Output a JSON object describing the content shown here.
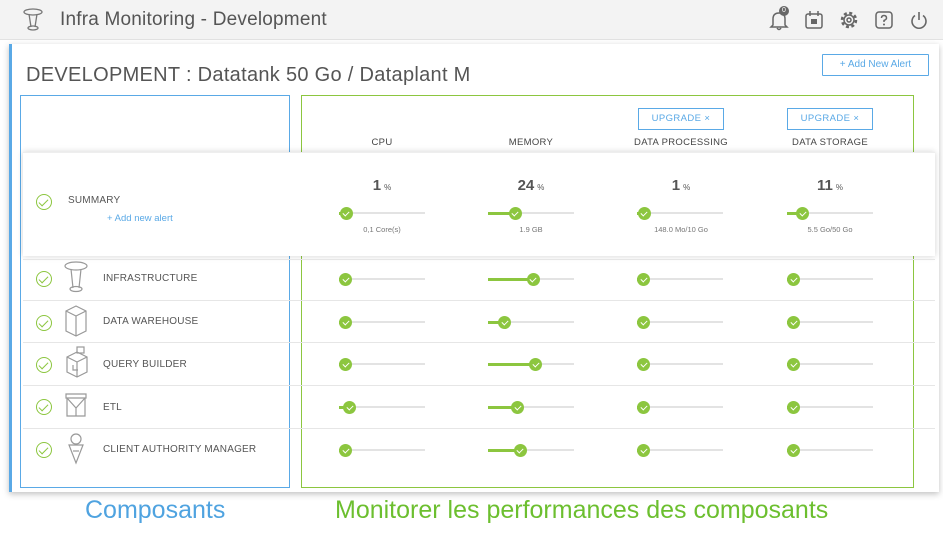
{
  "app": {
    "title": "Infra Monitoring - Development",
    "logo_icon": "infra-logo-icon",
    "notifications_count": "0",
    "header_icons": [
      "bell-icon",
      "calendar-icon",
      "gear-icon",
      "help-icon",
      "power-icon"
    ]
  },
  "page": {
    "title": "DEVELOPMENT : Datatank 50 Go / Dataplant M",
    "add_alert_label": "+ Add New Alert"
  },
  "columns": [
    {
      "key": "cpu",
      "label": "CPU",
      "upgrade": ""
    },
    {
      "key": "memory",
      "label": "MEMORY",
      "upgrade": ""
    },
    {
      "key": "processing",
      "label": "DATA PROCESSING",
      "upgrade": "UPGRADE ×"
    },
    {
      "key": "storage",
      "label": "DATA STORAGE",
      "upgrade": "UPGRADE ×"
    }
  ],
  "summary": {
    "label": "SUMMARY",
    "add_alert": "+ Add new alert",
    "cells": [
      {
        "value": "1",
        "unit": "%",
        "detail": "0,1 Core(s)",
        "level": 0.01
      },
      {
        "value": "24",
        "unit": "%",
        "detail": "1.9 GB",
        "level": 0.24
      },
      {
        "value": "1",
        "unit": "%",
        "detail": "148.0 Mo/10 Go",
        "level": 0.01
      },
      {
        "value": "11",
        "unit": "%",
        "detail": "5.5 Go/50 Go",
        "level": 0.11
      }
    ]
  },
  "components": [
    {
      "label": "INFRASTRUCTURE",
      "icon": "infrastructure-icon",
      "levels": [
        0.0,
        0.45,
        0.0,
        0.0
      ]
    },
    {
      "label": "DATA WAREHOUSE",
      "icon": "data-warehouse-icon",
      "levels": [
        0.0,
        0.12,
        0.0,
        0.0
      ]
    },
    {
      "label": "QUERY BUILDER",
      "icon": "query-builder-icon",
      "levels": [
        0.0,
        0.48,
        0.0,
        0.0
      ]
    },
    {
      "label": "ETL",
      "icon": "etl-icon",
      "levels": [
        0.05,
        0.27,
        0.0,
        0.0
      ]
    },
    {
      "label": "CLIENT AUTHORITY MANAGER",
      "icon": "client-authority-icon",
      "levels": [
        0.0,
        0.3,
        0.0,
        0.0
      ]
    }
  ],
  "captions": {
    "left": "Composants",
    "right": "Monitorer les performances des composants"
  },
  "colors": {
    "accent_blue": "#5aa9e6",
    "ok_green": "#8cc63f"
  }
}
